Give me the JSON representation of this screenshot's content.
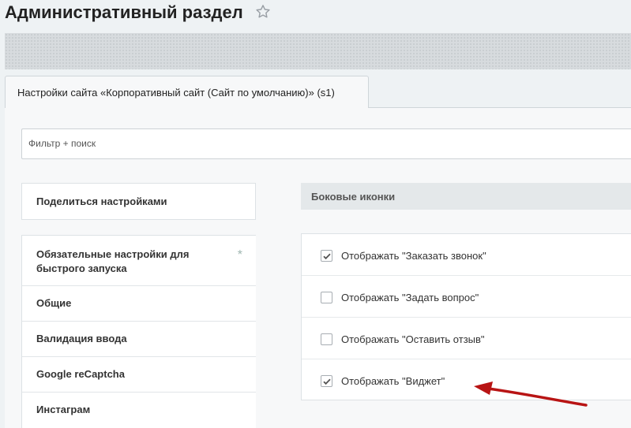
{
  "header": {
    "title": "Административный раздел",
    "star_icon": "star-outline-icon"
  },
  "tabs": [
    {
      "label": "Настройки сайта «Корпоративный сайт (Сайт по умолчанию)» (s1)",
      "active": true
    }
  ],
  "filter": {
    "value": "",
    "placeholder": "Фильтр + поиск"
  },
  "sidebar": {
    "share_label": "Поделиться настройками",
    "items": [
      {
        "label": "Обязательные настройки для быстрого запуска",
        "marker": "*"
      },
      {
        "label": "Общие"
      },
      {
        "label": "Валидация ввода"
      },
      {
        "label": "Google reCaptcha"
      },
      {
        "label": "Инстаграм"
      }
    ]
  },
  "section": {
    "title": "Боковые иконки",
    "options": [
      {
        "label": "Отображать \"Заказать звонок\"",
        "checked": true
      },
      {
        "label": "Отображать \"Задать вопрос\"",
        "checked": false
      },
      {
        "label": "Отображать \"Оставить отзыв\"",
        "checked": false
      },
      {
        "label": "Отображать \"Виджет\"",
        "checked": true
      }
    ]
  },
  "annotation": {
    "arrow_color": "#b81414",
    "arrow_icon": "red-arrow-icon"
  },
  "colors": {
    "page_bg": "#eef2f4",
    "panel_bg": "#f7f8f9",
    "section_header_bg": "#e4e8ea"
  }
}
